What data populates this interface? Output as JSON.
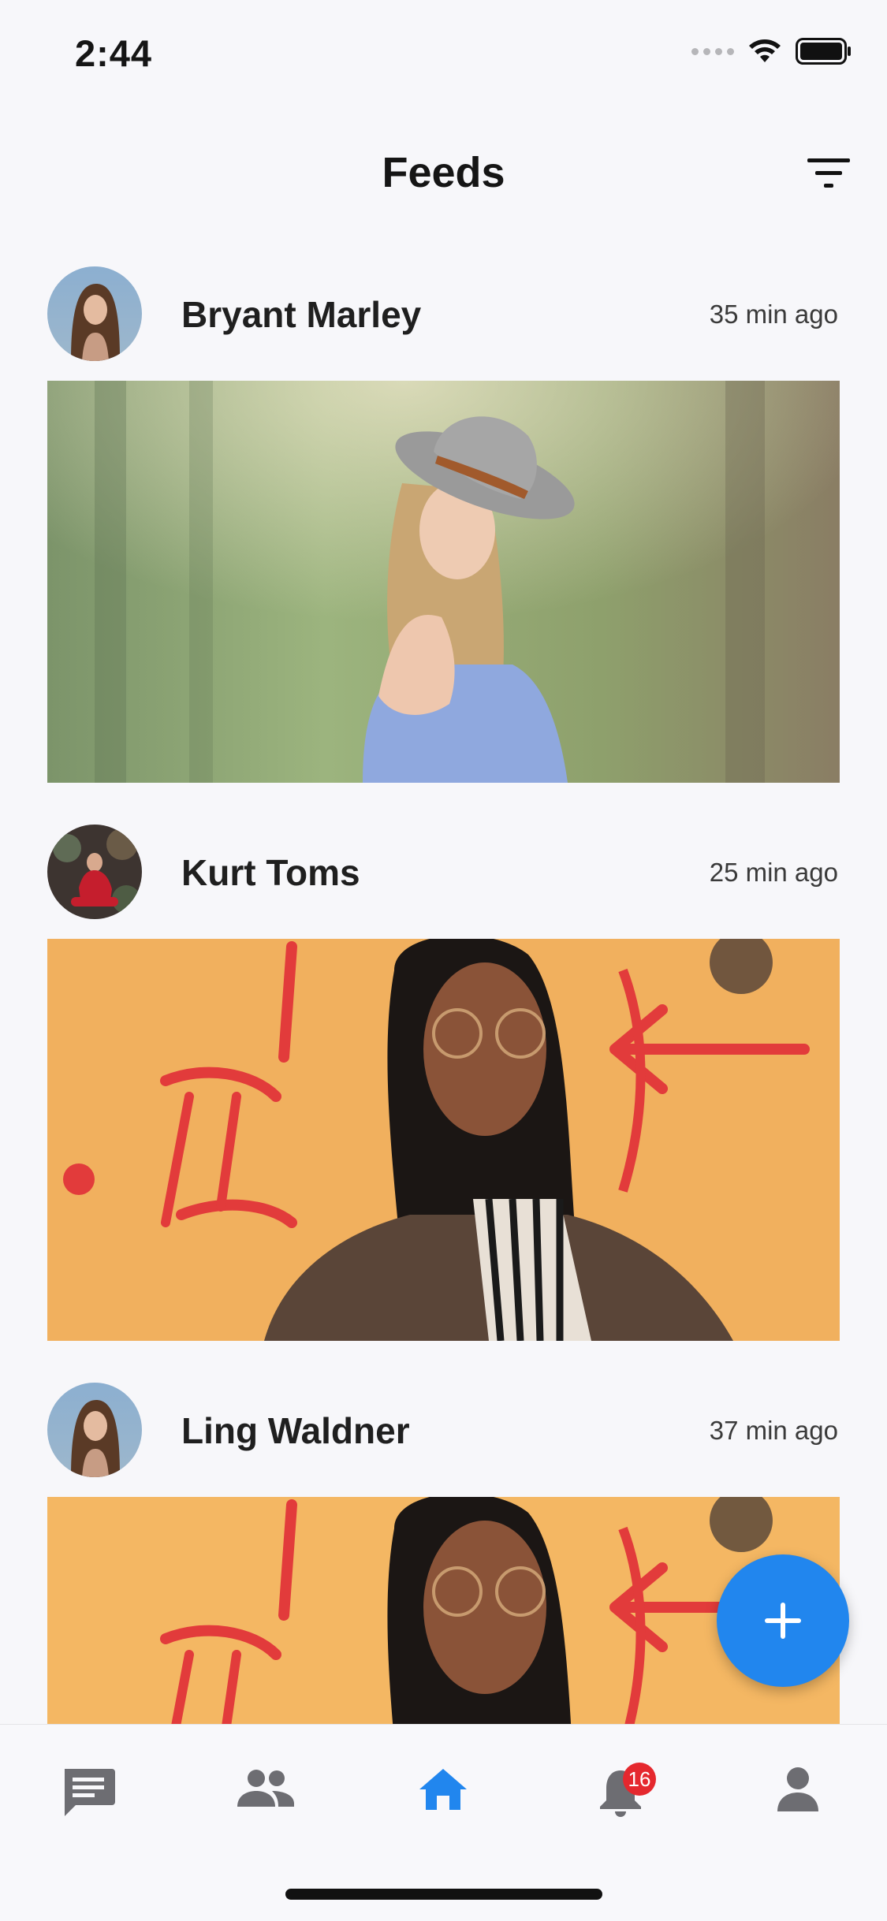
{
  "status_bar": {
    "time": "2:44"
  },
  "header": {
    "title": "Feeds",
    "filter_icon": "filter-icon"
  },
  "feed": {
    "items": [
      {
        "author": "Bryant Marley",
        "time": "35 min ago",
        "avatar": "avatar-woman-long-hair",
        "image": "woman-in-grey-hat-forest"
      },
      {
        "author": "Kurt Toms",
        "time": "25 min ago",
        "avatar": "avatar-woman-red-dress",
        "image": "woman-glasses-graffiti-wall"
      },
      {
        "author": "Ling Waldner",
        "time": "37 min ago",
        "avatar": "avatar-woman-long-hair",
        "image": "woman-glasses-graffiti-wall"
      }
    ]
  },
  "fab": {
    "icon": "plus-icon"
  },
  "bottom_nav": {
    "items": [
      {
        "icon": "chat-icon",
        "active": false
      },
      {
        "icon": "people-icon",
        "active": false
      },
      {
        "icon": "home-icon",
        "active": true
      },
      {
        "icon": "bell-icon",
        "active": false,
        "badge": "16"
      },
      {
        "icon": "profile-icon",
        "active": false
      }
    ]
  },
  "colors": {
    "accent": "#2186EE",
    "badge": "#E5282E",
    "icon_inactive": "#6D6D72",
    "background": "#F7F7FA"
  }
}
